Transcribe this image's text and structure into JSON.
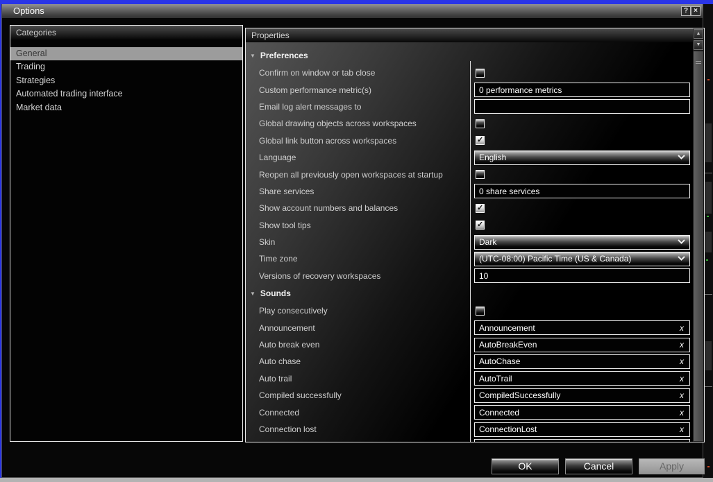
{
  "window": {
    "title": "Options",
    "titlebar_buttons": {
      "help": "?",
      "close": "×"
    }
  },
  "categories": {
    "header": "Categories",
    "items": [
      {
        "label": "General",
        "selected": true
      },
      {
        "label": "Trading",
        "selected": false
      },
      {
        "label": "Strategies",
        "selected": false
      },
      {
        "label": "Automated trading interface",
        "selected": false
      },
      {
        "label": "Market data",
        "selected": false
      }
    ]
  },
  "properties": {
    "header": "Properties",
    "clear_label": "x",
    "collapse_icon": "▼",
    "scrollbar": {
      "up_icon": "▲",
      "down_icon": "▼"
    },
    "sections": [
      {
        "title": "Preferences",
        "rows": [
          {
            "label": "Confirm on window or tab close",
            "type": "checkbox",
            "checked": false
          },
          {
            "label": "Custom performance metric(s)",
            "type": "text",
            "value": "0 performance metrics"
          },
          {
            "label": "Email log alert messages to",
            "type": "text",
            "value": ""
          },
          {
            "label": "Global drawing objects across workspaces",
            "type": "checkbox",
            "checked": false
          },
          {
            "label": "Global link button across workspaces",
            "type": "checkbox",
            "checked": true
          },
          {
            "label": "Language",
            "type": "dropdown",
            "value": "English"
          },
          {
            "label": "Reopen all previously open workspaces at startup",
            "type": "checkbox",
            "checked": false
          },
          {
            "label": "Share services",
            "type": "text",
            "value": "0 share services"
          },
          {
            "label": "Show account numbers and balances",
            "type": "checkbox",
            "checked": true
          },
          {
            "label": "Show tool tips",
            "type": "checkbox",
            "checked": true
          },
          {
            "label": "Skin",
            "type": "dropdown",
            "value": "Dark"
          },
          {
            "label": "Time zone",
            "type": "dropdown",
            "value": "(UTC-08:00) Pacific Time (US & Canada)"
          },
          {
            "label": "Versions of recovery workspaces",
            "type": "text",
            "value": "10"
          }
        ]
      },
      {
        "title": "Sounds",
        "rows": [
          {
            "label": "Play consecutively",
            "type": "checkbox",
            "checked": false
          },
          {
            "label": "Announcement",
            "type": "sound",
            "value": "Announcement"
          },
          {
            "label": "Auto break even",
            "type": "sound",
            "value": "AutoBreakEven"
          },
          {
            "label": "Auto chase",
            "type": "sound",
            "value": "AutoChase"
          },
          {
            "label": "Auto trail",
            "type": "sound",
            "value": "AutoTrail"
          },
          {
            "label": "Compiled successfully",
            "type": "sound",
            "value": "CompiledSuccessfully"
          },
          {
            "label": "Connected",
            "type": "sound",
            "value": "Connected"
          },
          {
            "label": "Connection lost",
            "type": "sound",
            "value": "ConnectionLost"
          },
          {
            "label": "",
            "type": "sound-partial",
            "value": ""
          }
        ]
      }
    ]
  },
  "footer": {
    "ok_label": "OK",
    "cancel_label": "Cancel",
    "apply_label": "Apply"
  },
  "colors": {
    "frame_blue": "#2a35e6",
    "selected_item_bg": "#9c9c9c",
    "field_border": "#efefef",
    "bottom_strip": "#b3b3b3",
    "titlebar_top": "#929292"
  }
}
